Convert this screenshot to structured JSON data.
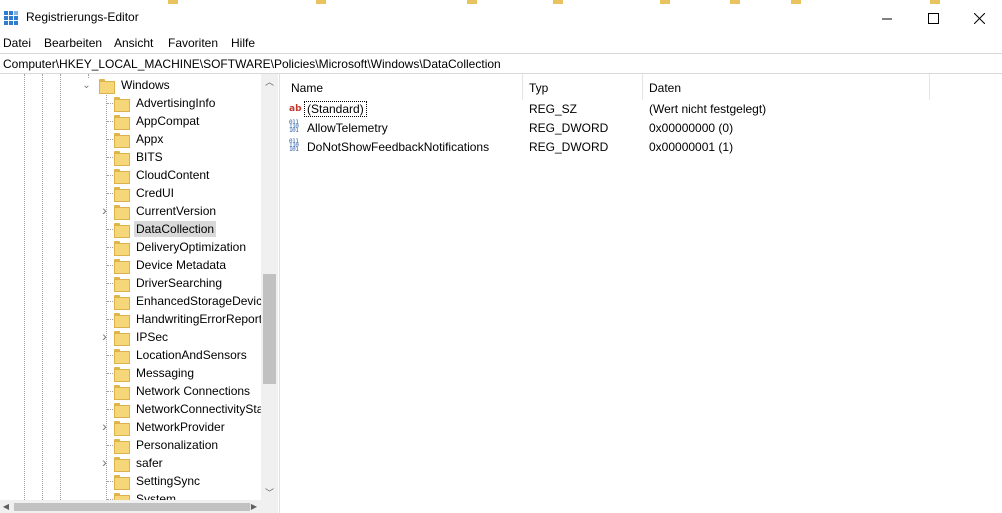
{
  "window": {
    "title": "Registrierungs-Editor",
    "minimize_icon": "minimize-icon",
    "maximize_icon": "maximize-icon",
    "close_icon": "close-icon"
  },
  "menu": [
    "Datei",
    "Bearbeiten",
    "Ansicht",
    "Favoriten",
    "Hilfe"
  ],
  "address": "Computer\\HKEY_LOCAL_MACHINE\\SOFTWARE\\Policies\\Microsoft\\Windows\\DataCollection",
  "tree": {
    "parent": "Windows",
    "children": [
      {
        "label": "AdvertisingInfo",
        "expandable": false
      },
      {
        "label": "AppCompat",
        "expandable": false
      },
      {
        "label": "Appx",
        "expandable": false
      },
      {
        "label": "BITS",
        "expandable": false
      },
      {
        "label": "CloudContent",
        "expandable": false
      },
      {
        "label": "CredUI",
        "expandable": false
      },
      {
        "label": "CurrentVersion",
        "expandable": true
      },
      {
        "label": "DataCollection",
        "expandable": false,
        "selected": true
      },
      {
        "label": "DeliveryOptimization",
        "expandable": false
      },
      {
        "label": "Device Metadata",
        "expandable": false
      },
      {
        "label": "DriverSearching",
        "expandable": false
      },
      {
        "label": "EnhancedStorageDevices",
        "expandable": false
      },
      {
        "label": "HandwritingErrorReports",
        "expandable": false
      },
      {
        "label": "IPSec",
        "expandable": true
      },
      {
        "label": "LocationAndSensors",
        "expandable": false
      },
      {
        "label": "Messaging",
        "expandable": false
      },
      {
        "label": "Network Connections",
        "expandable": false
      },
      {
        "label": "NetworkConnectivityStatusIndicator",
        "expandable": false
      },
      {
        "label": "NetworkProvider",
        "expandable": true
      },
      {
        "label": "Personalization",
        "expandable": false
      },
      {
        "label": "safer",
        "expandable": true
      },
      {
        "label": "SettingSync",
        "expandable": false
      },
      {
        "label": "System",
        "expandable": false
      }
    ]
  },
  "columns": {
    "name": "Name",
    "type": "Typ",
    "data": "Daten"
  },
  "values": [
    {
      "name": "(Standard)",
      "type": "REG_SZ",
      "data": "(Wert nicht festgelegt)",
      "icon": "string-value-icon"
    },
    {
      "name": "AllowTelemetry",
      "type": "REG_DWORD",
      "data": "0x00000000 (0)",
      "icon": "binary-value-icon"
    },
    {
      "name": "DoNotShowFeedbackNotifications",
      "type": "REG_DWORD",
      "data": "0x00000001 (1)",
      "icon": "binary-value-icon"
    }
  ],
  "colors": {
    "folder": "#f5d77a",
    "selection": "#d9d9d9",
    "accent": "#0078d7"
  }
}
